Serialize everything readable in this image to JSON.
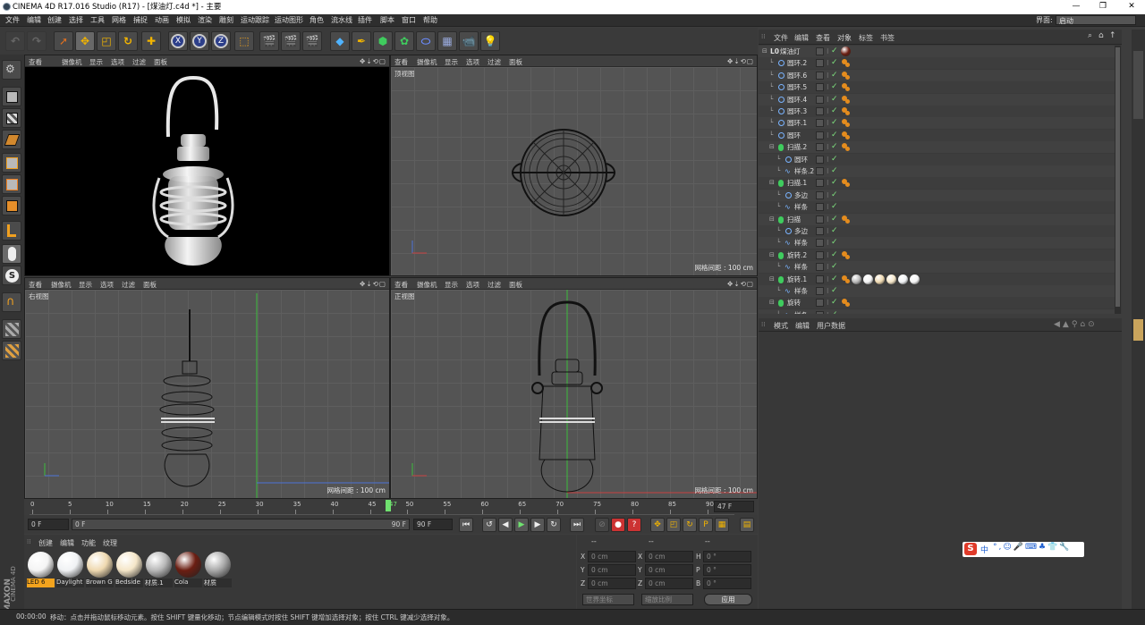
{
  "window": {
    "title": "CINEMA 4D R17.016 Studio (R17) - [煤油灯.c4d *] - 主要",
    "minimize": "—",
    "restore": "❐",
    "close": "✕"
  },
  "menubar": {
    "items": [
      "文件",
      "编辑",
      "创建",
      "选择",
      "工具",
      "网格",
      "捕捉",
      "动画",
      "模拟",
      "渲染",
      "雕刻",
      "运动跟踪",
      "运动图形",
      "角色",
      "流水线",
      "插件",
      "脚本",
      "窗口",
      "帮助"
    ],
    "layout_label": "界面:",
    "layout_value": "启动"
  },
  "viewport_menu": [
    "查看",
    "摄像机",
    "显示",
    "选项",
    "过滤",
    "面板"
  ],
  "viewports": {
    "perspective": {
      "name": ""
    },
    "top": {
      "name": "顶视图",
      "grid": "网格间距 : 100 cm"
    },
    "right": {
      "name": "右视图",
      "grid": "网格间距 : 100 cm"
    },
    "front": {
      "name": "正视图",
      "grid": "网格间距 : 100 cm"
    }
  },
  "timeline": {
    "ticks": [
      "0",
      "5",
      "10",
      "15",
      "20",
      "25",
      "30",
      "35",
      "40",
      "45",
      "50",
      "55",
      "60",
      "65",
      "70",
      "75",
      "80",
      "85",
      "90"
    ],
    "current_marker": "47",
    "current_frame": "47 F"
  },
  "transport": {
    "start": "0 F",
    "mid_start": "0 F",
    "mid_end": "90 F",
    "end": "90 F"
  },
  "material_panel": {
    "menu": [
      "创建",
      "编辑",
      "功能",
      "纹理"
    ],
    "materials": [
      {
        "name": "LED 6",
        "color": "#f4f4f4",
        "selected": true
      },
      {
        "name": "Daylight",
        "color": "#f0f2f4",
        "selected": false
      },
      {
        "name": "Brown G",
        "color": "#efd9b0",
        "selected": false
      },
      {
        "name": "Bedside",
        "color": "#f5e6c8",
        "selected": false
      },
      {
        "name": "材质.1",
        "color": "#b8b8b8",
        "selected": false
      },
      {
        "name": "Cola",
        "color": "#6b1e12",
        "selected": false
      },
      {
        "name": "材质",
        "color": "#a9a9a9",
        "selected": false
      }
    ]
  },
  "coord_panel": {
    "headers": [
      "--",
      "--",
      "--"
    ],
    "rows": [
      {
        "a": "X",
        "av": "0 cm",
        "b": "X",
        "bv": "0 cm",
        "c": "H",
        "cv": "0 °"
      },
      {
        "a": "Y",
        "av": "0 cm",
        "b": "Y",
        "bv": "0 cm",
        "c": "P",
        "cv": "0 °"
      },
      {
        "a": "Z",
        "av": "0 cm",
        "b": "Z",
        "bv": "0 cm",
        "c": "B",
        "cv": "0 °"
      }
    ],
    "world_coords": "世界坐标",
    "scale_ratio": "缩放比例",
    "apply": "应用"
  },
  "object_manager": {
    "menu": [
      "文件",
      "编辑",
      "查看",
      "对象",
      "标签",
      "书签"
    ],
    "rows": [
      {
        "name": "煤油灯",
        "indent": 0,
        "type": "null",
        "tags": 0,
        "mtags": 1
      },
      {
        "name": "圆环.2",
        "indent": 1,
        "type": "torus",
        "tags": 1,
        "mtags": 0
      },
      {
        "name": "圆环.6",
        "indent": 1,
        "type": "torus",
        "tags": 1,
        "mtags": 0
      },
      {
        "name": "圆环.5",
        "indent": 1,
        "type": "torus",
        "tags": 1,
        "mtags": 0
      },
      {
        "name": "圆环.4",
        "indent": 1,
        "type": "torus",
        "tags": 1,
        "mtags": 0
      },
      {
        "name": "圆环.3",
        "indent": 1,
        "type": "torus",
        "tags": 1,
        "mtags": 0
      },
      {
        "name": "圆环.1",
        "indent": 1,
        "type": "torus",
        "tags": 1,
        "mtags": 0
      },
      {
        "name": "圆环",
        "indent": 1,
        "type": "torus",
        "tags": 1,
        "mtags": 0
      },
      {
        "name": "扫描.2",
        "indent": 1,
        "type": "sweep",
        "tags": 1,
        "mtags": 0
      },
      {
        "name": "圆环",
        "indent": 2,
        "type": "circle",
        "tags": 0,
        "mtags": 0
      },
      {
        "name": "样条.2",
        "indent": 2,
        "type": "spline",
        "tags": 0,
        "mtags": 0
      },
      {
        "name": "扫描.1",
        "indent": 1,
        "type": "sweep",
        "tags": 1,
        "mtags": 0
      },
      {
        "name": "多边",
        "indent": 2,
        "type": "circle",
        "tags": 0,
        "mtags": 0
      },
      {
        "name": "样条",
        "indent": 2,
        "type": "spline",
        "tags": 0,
        "mtags": 0
      },
      {
        "name": "扫描",
        "indent": 1,
        "type": "sweep",
        "tags": 1,
        "mtags": 0
      },
      {
        "name": "多边",
        "indent": 2,
        "type": "circle",
        "tags": 0,
        "mtags": 0
      },
      {
        "name": "样条",
        "indent": 2,
        "type": "spline",
        "tags": 0,
        "mtags": 0
      },
      {
        "name": "旋转.2",
        "indent": 1,
        "type": "lathe",
        "tags": 1,
        "mtags": 0
      },
      {
        "name": "样条",
        "indent": 2,
        "type": "spline",
        "tags": 0,
        "mtags": 0
      },
      {
        "name": "旋转.1",
        "indent": 1,
        "type": "lathe",
        "tags": 1,
        "mtags": 6
      },
      {
        "name": "样条",
        "indent": 2,
        "type": "spline",
        "tags": 0,
        "mtags": 0
      },
      {
        "name": "旋转",
        "indent": 1,
        "type": "lathe",
        "tags": 1,
        "mtags": 0
      },
      {
        "name": "样条",
        "indent": 2,
        "type": "spline",
        "tags": 0,
        "mtags": 0
      }
    ]
  },
  "attribute_manager": {
    "menu": [
      "模式",
      "编辑",
      "用户数据"
    ]
  },
  "status": {
    "time": "00:00:00",
    "message": "移动：点击并拖动鼠标移动元素。按住 SHIFT 键量化移动；节点编辑模式时按住 SHIFT 键增加选择对象；按住 CTRL 键减少选择对象。"
  },
  "ime_toolbar": {
    "label": "中"
  },
  "brand": {
    "line1": "MAXON",
    "line2": "CINEMA 4D"
  },
  "colors": {
    "accent": "#5a8fd0",
    "active_frame": "#6fe06f",
    "tag_orange": "#e48c1e",
    "axis_x": "#c94040",
    "axis_y": "#3dbb3d",
    "axis_z": "#4b72d6"
  }
}
